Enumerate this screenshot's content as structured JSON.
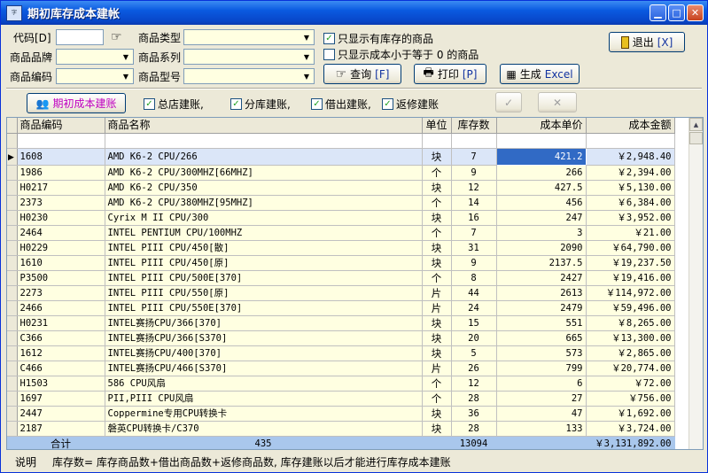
{
  "window": {
    "title": "期初库存成本建帐",
    "icon_text": "字"
  },
  "filters": {
    "code_label": "代码[D]",
    "type_label": "商品类型",
    "brand_label": "商品品牌",
    "series_label": "商品系列",
    "item_code_label": "商品编码",
    "model_label": "商品型号",
    "only_stock_label": "只显示有库存的商品",
    "only_stock_checked": true,
    "cost_zero_label": "只显示成本小于等于 0 的商品",
    "cost_zero_checked": false
  },
  "buttons": {
    "query_label": "查询",
    "query_key": "[F]",
    "print_label": "打印",
    "print_key": "[P]",
    "excel_label": "生成",
    "excel_key": "Excel",
    "exit_label": "退出",
    "exit_key": "[X]",
    "initial_cost_label": "期初成本建账"
  },
  "options": [
    {
      "label": "总店建账,",
      "checked": true
    },
    {
      "label": "分库建账,",
      "checked": true
    },
    {
      "label": "借出建账,",
      "checked": true
    },
    {
      "label": "返修建账",
      "checked": true
    }
  ],
  "table": {
    "columns": [
      "商品编码",
      "商品名称",
      "单位",
      "库存数",
      "成本单价",
      "成本金额"
    ],
    "rows": [
      {
        "code": "1608",
        "name": "AMD K6-2 CPU/266",
        "unit": "块",
        "qty": "7",
        "price": "421.2",
        "amount": "￥2,948.40"
      },
      {
        "code": "1986",
        "name": "AMD K6-2 CPU/300MHZ[66MHZ]",
        "unit": "个",
        "qty": "9",
        "price": "266",
        "amount": "￥2,394.00"
      },
      {
        "code": "H0217",
        "name": "AMD K6-2 CPU/350",
        "unit": "块",
        "qty": "12",
        "price": "427.5",
        "amount": "￥5,130.00"
      },
      {
        "code": "2373",
        "name": "AMD K6-2 CPU/380MHZ[95MHZ]",
        "unit": "个",
        "qty": "14",
        "price": "456",
        "amount": "￥6,384.00"
      },
      {
        "code": "H0230",
        "name": "Cyrix M II CPU/300",
        "unit": "块",
        "qty": "16",
        "price": "247",
        "amount": "￥3,952.00"
      },
      {
        "code": "2464",
        "name": "INTEL PENTIUM CPU/100MHZ",
        "unit": "个",
        "qty": "7",
        "price": "3",
        "amount": "￥21.00"
      },
      {
        "code": "H0229",
        "name": "INTEL PIII CPU/450[散]",
        "unit": "块",
        "qty": "31",
        "price": "2090",
        "amount": "￥64,790.00"
      },
      {
        "code": "1610",
        "name": "INTEL PIII CPU/450[原]",
        "unit": "块",
        "qty": "9",
        "price": "2137.5",
        "amount": "￥19,237.50"
      },
      {
        "code": "P3500",
        "name": "INTEL PIII CPU/500E[370]",
        "unit": "个",
        "qty": "8",
        "price": "2427",
        "amount": "￥19,416.00"
      },
      {
        "code": "2273",
        "name": "INTEL PIII CPU/550[原]",
        "unit": "片",
        "qty": "44",
        "price": "2613",
        "amount": "￥114,972.00"
      },
      {
        "code": "2466",
        "name": "INTEL PIII CPU/550E[370]",
        "unit": "片",
        "qty": "24",
        "price": "2479",
        "amount": "￥59,496.00"
      },
      {
        "code": "H0231",
        "name": "INTEL赛扬CPU/366[370]",
        "unit": "块",
        "qty": "15",
        "price": "551",
        "amount": "￥8,265.00"
      },
      {
        "code": "C366",
        "name": "INTEL赛扬CPU/366[S370]",
        "unit": "块",
        "qty": "20",
        "price": "665",
        "amount": "￥13,300.00"
      },
      {
        "code": "1612",
        "name": "INTEL赛扬CPU/400[370]",
        "unit": "块",
        "qty": "5",
        "price": "573",
        "amount": "￥2,865.00"
      },
      {
        "code": "C466",
        "name": "INTEL赛扬CPU/466[S370]",
        "unit": "片",
        "qty": "26",
        "price": "799",
        "amount": "￥20,774.00"
      },
      {
        "code": "H1503",
        "name": "586 CPU风扇",
        "unit": "个",
        "qty": "12",
        "price": "6",
        "amount": "￥72.00"
      },
      {
        "code": "1697",
        "name": "PII,PIII CPU风扇",
        "unit": "个",
        "qty": "28",
        "price": "27",
        "amount": "￥756.00"
      },
      {
        "code": "2447",
        "name": "Coppermine专用CPU转换卡",
        "unit": "块",
        "qty": "36",
        "price": "47",
        "amount": "￥1,692.00"
      },
      {
        "code": "2187",
        "name": "磐英CPU转换卡/C370",
        "unit": "块",
        "qty": "28",
        "price": "133",
        "amount": "￥3,724.00"
      }
    ],
    "total": {
      "label": "合计",
      "count": "435",
      "qty": "13094",
      "amount": "￥3,131,892.00"
    }
  },
  "status": {
    "label": "说明",
    "text": "库存数= 库存商品数+借出商品数+返修商品数, 库存建账以后才能进行库存成本建账"
  }
}
